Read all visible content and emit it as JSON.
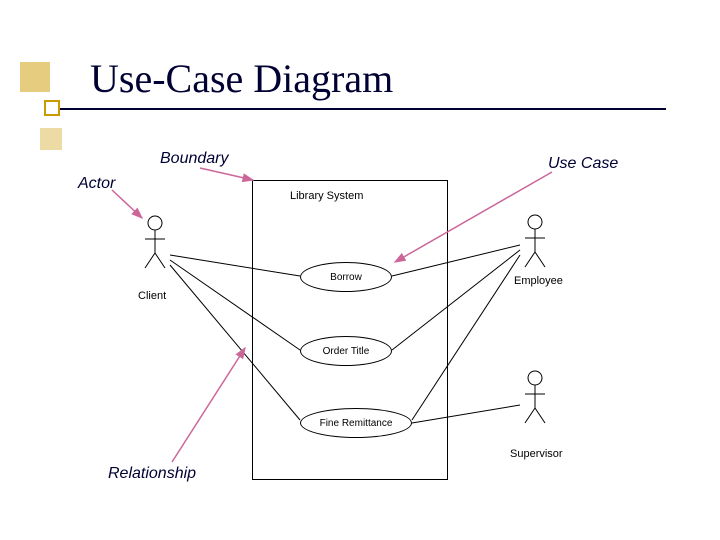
{
  "title": "Use-Case Diagram",
  "labels": {
    "boundary": "Boundary",
    "actor": "Actor",
    "usecase": "Use Case",
    "relationship": "Relationship"
  },
  "system": {
    "name": "Library System"
  },
  "usecases": {
    "borrow": "Borrow",
    "order": "Order Title",
    "fine": "Fine Remittance"
  },
  "actors": {
    "client": "Client",
    "employee": "Employee",
    "supervisor": "Supervisor"
  }
}
